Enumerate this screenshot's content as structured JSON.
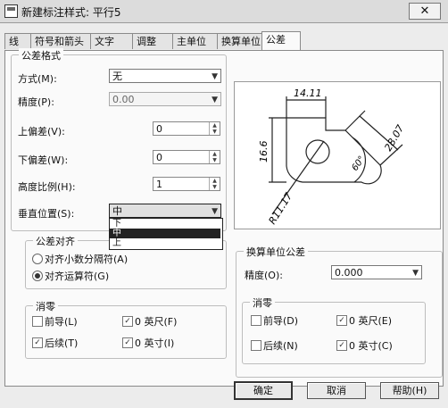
{
  "window": {
    "title": "新建标注样式: 平行5",
    "close_glyph": "✕"
  },
  "tabs": [
    {
      "label": "线"
    },
    {
      "label": "符号和箭头"
    },
    {
      "label": "文字"
    },
    {
      "label": "调整"
    },
    {
      "label": "主单位"
    },
    {
      "label": "换算单位"
    },
    {
      "label": "公差"
    }
  ],
  "tolerance_format": {
    "group_title": "公差格式",
    "method_label": "方式(M):",
    "method_value": "无",
    "precision_label": "精度(P):",
    "precision_value": "0.00",
    "upper_label": "上偏差(V):",
    "upper_value": "0",
    "lower_label": "下偏差(W):",
    "lower_value": "0",
    "height_label": "高度比例(H):",
    "height_value": "1",
    "vpos_label": "垂直位置(S):",
    "vpos_value": "中",
    "vpos_options": [
      "下",
      "中",
      "上"
    ],
    "vpos_selected_index": 1
  },
  "tolerance_alignment": {
    "group_title": "公差对齐",
    "align_decimal": "对齐小数分隔符(A)",
    "align_operator": "对齐运算符(G)",
    "selected": "align_operator"
  },
  "zero_suppression": {
    "group_title": "消零",
    "leading": "前导(L)",
    "trailing": "后续(T)",
    "feet": "0 英尺(F)",
    "inches": "0 英寸(I)",
    "leading_checked": false,
    "trailing_checked": true,
    "feet_checked": true,
    "inches_checked": true
  },
  "alt_unit_tolerance": {
    "group_title": "换算单位公差",
    "precision_label": "精度(O):",
    "precision_value": "0.000"
  },
  "alt_zero_suppression": {
    "group_title": "消零",
    "leading": "前导(D)",
    "trailing": "后续(N)",
    "feet": "0 英尺(E)",
    "inches": "0 英寸(C)",
    "leading_checked": false,
    "trailing_checked": false,
    "feet_checked": true,
    "inches_checked": true
  },
  "preview": {
    "dim_top": "14.11",
    "dim_left": "16.6",
    "dim_right": "28.07",
    "dim_angle": "60°",
    "dim_radius": "R11.17"
  },
  "buttons": {
    "ok": "确定",
    "cancel": "取消",
    "help": "帮助(H)"
  },
  "glyphs": {
    "combo_arrow": "▼",
    "spin_up": "▲",
    "spin_down": "▼",
    "check": "✓"
  }
}
